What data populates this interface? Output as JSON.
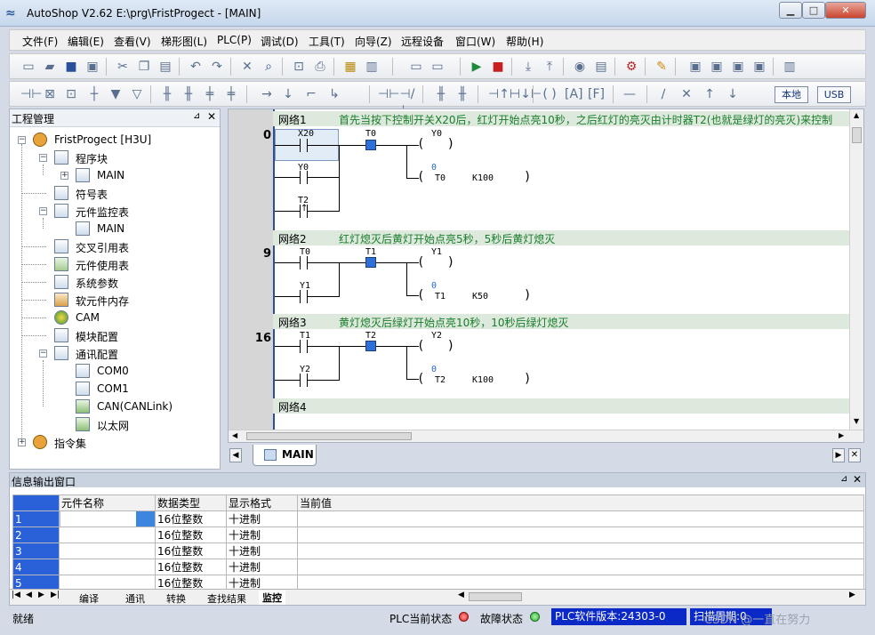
{
  "window": {
    "title": "AutoShop V2.62  E:\\prg\\FristProgect - [MAIN]",
    "min": "▁",
    "max": "□",
    "close": "✕"
  },
  "menu": [
    "文件(F)",
    "编辑(E)",
    "查看(V)",
    "梯形图(L)",
    "PLC(P)",
    "调试(D)",
    "工具(T)",
    "向导(Z)",
    "远程设备",
    "窗口(W)",
    "帮助(H)"
  ],
  "toolbar2": {
    "local": "本地",
    "usb": "USB"
  },
  "project": {
    "title": "工程管理",
    "pin": "⊿",
    "close": "✕",
    "root": "FristProgect [H3U]",
    "items": {
      "program_block": "程序块",
      "main1": "MAIN",
      "symbols": "符号表",
      "monitor": "元件监控表",
      "main2": "MAIN",
      "xref": "交叉引用表",
      "usage": "元件使用表",
      "sysparam": "系统参数",
      "memory": "软元件内存",
      "cam": "CAM",
      "module": "模块配置",
      "comm": "通讯配置",
      "com0": "COM0",
      "com1": "COM1",
      "can": "CAN(CANLink)",
      "ethernet": "以太网",
      "instr": "指令集"
    }
  },
  "ladder": {
    "networks": [
      {
        "name": "网络1",
        "step": "0",
        "comment": "首先当按下控制开关X20后，红灯开始点亮10秒，之后红灯的亮灭由计时器T2(也就是绿灯的亮灭)来控制",
        "c1": "X20",
        "c2": "T0",
        "c3": "Y0",
        "c4": "T2",
        "coil1": "Y0",
        "coil2": "T0",
        "k": "K100",
        "val": "0"
      },
      {
        "name": "网络2",
        "step": "9",
        "comment": "红灯熄灭后黄灯开始点亮5秒，5秒后黄灯熄灭",
        "c1": "T0",
        "c2": "T1",
        "c3": "Y1",
        "coil1": "Y1",
        "coil2": "T1",
        "k": "K50",
        "val": "0"
      },
      {
        "name": "网络3",
        "step": "16",
        "comment": "黄灯熄灭后绿灯开始点亮10秒，10秒后绿灯熄灭",
        "c1": "T1",
        "c2": "T2",
        "c3": "Y2",
        "coil1": "Y2",
        "coil2": "T2",
        "k": "K100",
        "val": "0"
      },
      {
        "name": "网络4"
      }
    ]
  },
  "tab": {
    "main": "MAIN"
  },
  "info": {
    "title": "信息输出窗口",
    "columns": [
      "元件名称",
      "数据类型",
      "显示格式",
      "当前值"
    ],
    "rows": [
      {
        "n": "1",
        "type": "16位整数",
        "fmt": "十进制"
      },
      {
        "n": "2",
        "type": "16位整数",
        "fmt": "十进制"
      },
      {
        "n": "3",
        "type": "16位整数",
        "fmt": "十进制"
      },
      {
        "n": "4",
        "type": "16位整数",
        "fmt": "十进制"
      },
      {
        "n": "5",
        "type": "16位整数",
        "fmt": "十进制"
      }
    ],
    "tabs": [
      "编译",
      "通讯",
      "转换",
      "查找结果",
      "监控"
    ]
  },
  "status": {
    "ready": "就绪",
    "plc_state": "PLC当前状态",
    "fault": "故障状态",
    "version": "PLC软件版本:24303-0",
    "scan": "扫描周期:0",
    "watermark": "CSDN @一直在努力",
    "colors": {
      "plc_led": "#e02020",
      "fault_led": "#2fb52f",
      "status_blue": "#0a29c6"
    }
  }
}
